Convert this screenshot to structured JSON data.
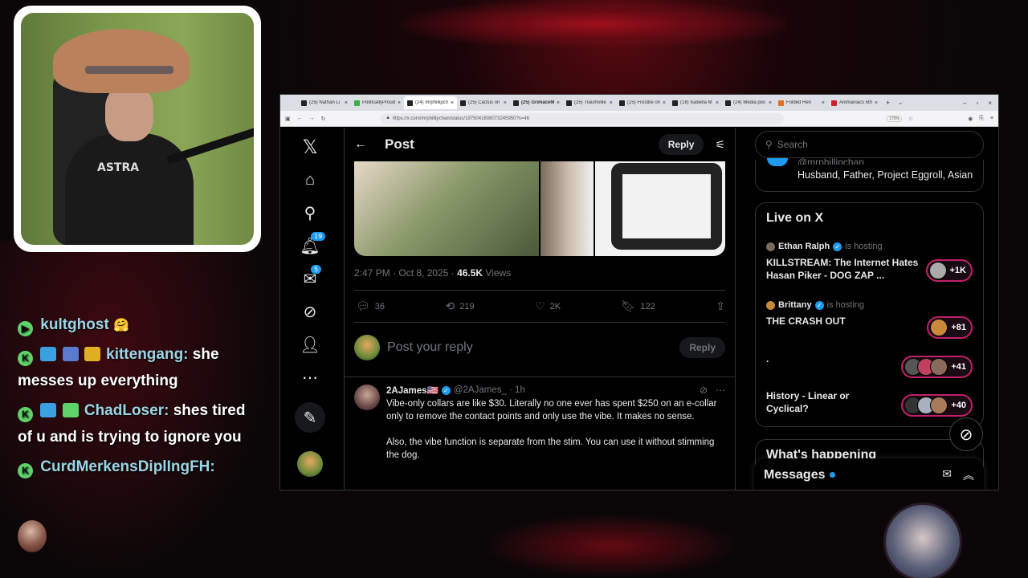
{
  "chat": {
    "lines": [
      {
        "user": "kultghost",
        "text": "",
        "emote": "🤗"
      },
      {
        "user": "kittengang:",
        "text": "she messes up everything"
      },
      {
        "user": "ChadLoser:",
        "text": "shes tired of u and is trying to ignore you"
      },
      {
        "user": "CurdMerkensDiplIngFH:",
        "text": ""
      }
    ]
  },
  "webcam": {
    "shirt_print": "ASTRA"
  },
  "browser": {
    "tabs": [
      {
        "label": "(25) Nathan Li"
      },
      {
        "label": "PoliticallyProud"
      },
      {
        "label": "(24) mrphillipch"
      },
      {
        "label": "(25) Cactus on"
      },
      {
        "label": "(25) GrimaceMe"
      },
      {
        "label": "(25) Traumville"
      },
      {
        "label": "(25) Frostbe on"
      },
      {
        "label": "(18) Isabella M"
      },
      {
        "label": "(24) Media pos"
      },
      {
        "label": "Folded Hen"
      },
      {
        "label": "Animaniacs 5th"
      }
    ],
    "url": "https://x.com/mrphillipchan/status/1975041608073245950?s=46",
    "zoom": "170%"
  },
  "header": {
    "title": "Post",
    "reply_button": "Reply"
  },
  "post": {
    "time": "2:47 PM · Oct 8, 2025 · ",
    "views_count": "46.5K",
    "views_label": " Views",
    "replies": "36",
    "reposts": "219",
    "likes": "2K",
    "bookmarks": "122"
  },
  "reply_box": {
    "placeholder": "Post your reply",
    "button": "Reply"
  },
  "reply_tweet": {
    "name": "2AJames🇺🇸",
    "handle": "@2AJames_ · 1h",
    "paragraph1": "Vibe-only collars are like $30. Literally no one ever has spent $250 on an e-collar only to remove the contact points and only use the vibe. It makes no sense.",
    "paragraph2": "Also, the vibe function is separate from the stim. You can use it without stimming the dog."
  },
  "nav": {
    "notif_count": "19",
    "msg_count": "5"
  },
  "right": {
    "search_placeholder": "Search",
    "top_card_handle": "@mrphillipchan",
    "top_card_bio": "Husband, Father, Project Eggroll, Asian",
    "live_title": "Live on X",
    "live_items": [
      {
        "host": "Ethan Ralph",
        "hosting": "is hosting",
        "title": "KILLSTREAM: The Internet Hates Hasan Piker - DOG ZAP ...",
        "count": "+1K"
      },
      {
        "host": "Brittany",
        "hosting": "is hosting",
        "title": "THE CRASH OUT",
        "count": "+81"
      },
      {
        "host": "",
        "hosting": "",
        "title": ".",
        "count": "+41"
      },
      {
        "host": "",
        "hosting": "",
        "title": "History - Linear or Cyclical?",
        "count": "+40"
      }
    ],
    "whats_happening": "What's happening",
    "messages": "Messages"
  },
  "colors": {
    "accent": "#1d9bf0",
    "live_ring": "#c0206a"
  }
}
